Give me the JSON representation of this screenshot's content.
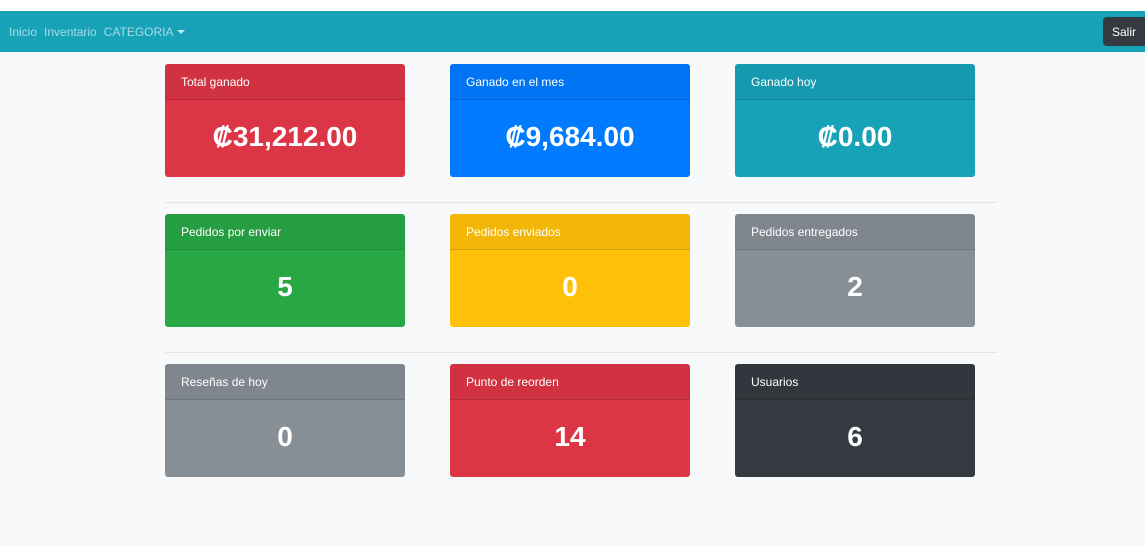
{
  "navbar": {
    "links": [
      "Inicio",
      "Inventario",
      "CATEGORIA"
    ],
    "logout_label": "Salir"
  },
  "colors": {
    "navbar_bg": "#17a2b8",
    "danger": "#dc3545",
    "primary": "#007bff",
    "info": "#17a2b8",
    "success": "#28a745",
    "warning": "#ffc107",
    "secondary": "#868e96",
    "dark": "#343a40"
  },
  "dashboard": {
    "rows": [
      [
        {
          "title": "Total ganado",
          "value": "₡31,212.00",
          "color": "#dc3545"
        },
        {
          "title": "Ganado en el mes",
          "value": "₡9,684.00",
          "color": "#007bff"
        },
        {
          "title": "Ganado hoy",
          "value": "₡0.00",
          "color": "#17a2b8"
        }
      ],
      [
        {
          "title": "Pedidos por enviar",
          "value": "5",
          "color": "#28a745"
        },
        {
          "title": "Pedidos enviados",
          "value": "0",
          "color": "#ffc107"
        },
        {
          "title": "Pedidos entregados",
          "value": "2",
          "color": "#868e96"
        }
      ],
      [
        {
          "title": "Reseñas de hoy",
          "value": "0",
          "color": "#868e96"
        },
        {
          "title": "Punto de reorden",
          "value": "14",
          "color": "#dc3545"
        },
        {
          "title": "Usuarios",
          "value": "6",
          "color": "#343a40"
        }
      ]
    ]
  }
}
